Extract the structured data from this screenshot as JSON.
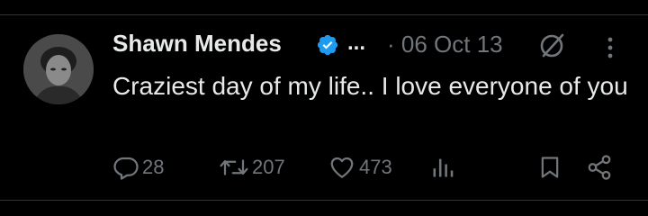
{
  "tweet": {
    "author_name": "Shawn Mendes",
    "author_truncation": "...",
    "date": "· 06 Oct 13",
    "text": "Craziest day of my life.. I love everyone of you",
    "metrics": {
      "replies": "28",
      "retweets": "207",
      "likes": "473"
    }
  },
  "colors": {
    "background": "#000000",
    "text": "#e7e9ea",
    "muted": "#71767b",
    "verified": "#1d9bf0"
  },
  "icons": [
    "verified-badge-icon",
    "grok-icon",
    "more-icon",
    "reply-icon",
    "retweet-icon",
    "like-icon",
    "views-icon",
    "bookmark-icon",
    "share-icon"
  ]
}
